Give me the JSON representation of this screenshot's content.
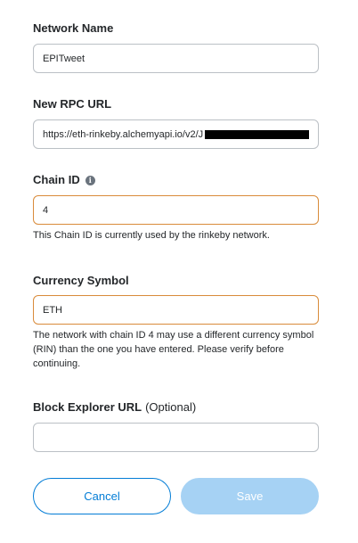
{
  "form": {
    "network_name": {
      "label": "Network Name",
      "value": "EPITweet"
    },
    "rpc_url": {
      "label": "New RPC URL",
      "value": "https://eth-rinkeby.alchemyapi.io/v2/J"
    },
    "chain_id": {
      "label": "Chain ID",
      "value": "4",
      "helper": "This Chain ID is currently used by the rinkeby network."
    },
    "currency_symbol": {
      "label": "Currency Symbol",
      "value": "ETH",
      "helper": "The network with chain ID 4 may use a different currency symbol (RIN) than the one you have entered. Please verify before continuing."
    },
    "block_explorer": {
      "label": "Block Explorer URL",
      "optional": "(Optional)",
      "value": ""
    }
  },
  "buttons": {
    "cancel": "Cancel",
    "save": "Save"
  },
  "colors": {
    "primary": "#037dd6",
    "warning_border": "#d98b3a",
    "disabled_fill": "#a6d2f4"
  },
  "icons": {
    "chain_id_info": "info-icon"
  }
}
